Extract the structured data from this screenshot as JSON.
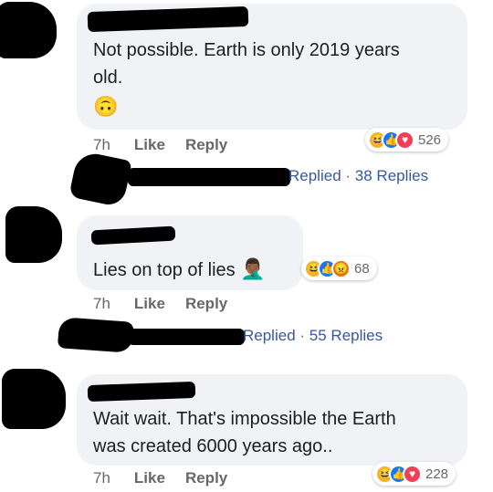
{
  "comments": [
    {
      "text_lines": [
        "Not possible. Earth is only 2019 years",
        "old."
      ],
      "emoji": "🙃",
      "time": "7h",
      "like": "Like",
      "reply": "Reply",
      "reactions": [
        "haha",
        "like",
        "love"
      ],
      "reaction_count": "526"
    },
    {
      "text": "Lies on top of lies",
      "emoji": "🤦🏾‍♂️",
      "time": "7h",
      "like": "Like",
      "reply": "Reply",
      "reactions": [
        "haha",
        "like",
        "angry"
      ],
      "reaction_count": "68"
    },
    {
      "text_lines": [
        "Wait wait.  That's impossible the Earth",
        "was created 6000 years ago.."
      ],
      "time": "7h",
      "like": "Like",
      "reply": "Reply",
      "reactions": [
        "haha",
        "like",
        "love"
      ],
      "reaction_count": "228"
    }
  ],
  "reply_threads": [
    {
      "replied": "Replied",
      "sep": "·",
      "count": "38 Replies"
    },
    {
      "replied": "Replied",
      "sep": "·",
      "count": "55 Replies"
    }
  ],
  "colors": {
    "bubble": "#f0f2f5",
    "meta": "#65676b",
    "link": "#385898",
    "redaction": "#000000"
  }
}
